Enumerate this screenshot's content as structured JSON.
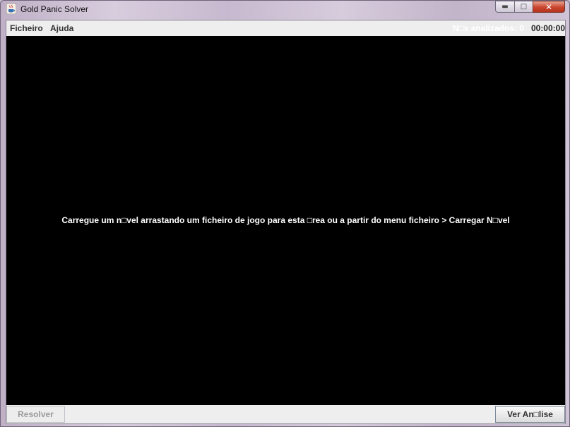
{
  "window": {
    "title": "Gold Panic Solver",
    "icon": "java-cup-icon",
    "controls": {
      "minimize": "minimize-icon",
      "maximize": "maximize-icon",
      "close": "close-icon"
    }
  },
  "menubar": {
    "items": [
      "Ficheiro",
      "Ajuda"
    ],
    "nodes_analyzed": "N□s analizados: 0",
    "timer": "00:00:00"
  },
  "canvas": {
    "message": "Carregue um n□vel arrastando um ficheiro de jogo para esta □rea ou a partir do menu ficheiro > Carregar N□vel"
  },
  "bottom": {
    "resolver_label": "Resolver",
    "ver_analise_label": "Ver An□lise"
  },
  "colors": {
    "canvas_bg": "#000000",
    "close_button": "#c8462f"
  }
}
